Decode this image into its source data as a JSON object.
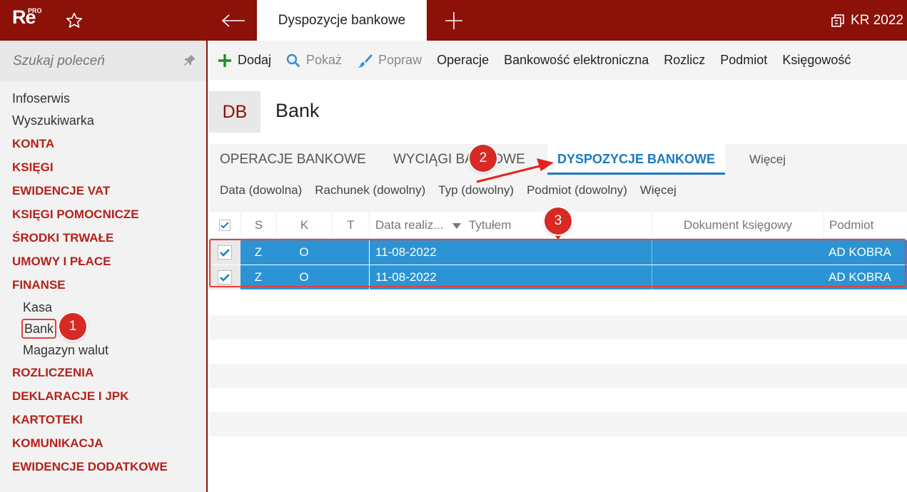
{
  "topbar": {
    "logo": "Re",
    "logo_badge": "PRO",
    "active_tab": "Dyspozycje bankowe",
    "company": "KR 2022"
  },
  "sidebar": {
    "search_placeholder": "Szukaj poleceń",
    "items": [
      {
        "label": "Infoserwis"
      },
      {
        "label": "Wyszukiwarka"
      },
      {
        "label": "KONTA"
      },
      {
        "label": "KSIĘGI"
      },
      {
        "label": "EWIDENCJE VAT"
      },
      {
        "label": "KSIĘGI POMOCNICZE"
      },
      {
        "label": "ŚRODKI TRWAŁE"
      },
      {
        "label": "UMOWY I PŁACE"
      },
      {
        "label": "FINANSE"
      },
      {
        "label": "Kasa"
      },
      {
        "label": "Bank"
      },
      {
        "label": "Magazyn walut"
      },
      {
        "label": "ROZLICZENIA"
      },
      {
        "label": "DEKLARACJE I JPK"
      },
      {
        "label": "KARTOTEKI"
      },
      {
        "label": "KOMUNIKACJA"
      },
      {
        "label": "EWIDENCJE DODATKOWE"
      }
    ]
  },
  "toolbar": {
    "add": "Dodaj",
    "show": "Pokaż",
    "edit": "Popraw",
    "operations": "Operacje",
    "ebanking": "Bankowość elektroniczna",
    "settle": "Rozlicz",
    "entity": "Podmiot",
    "accounting": "Księgowość"
  },
  "header": {
    "badge": "DB",
    "title": "Bank"
  },
  "tabs": {
    "t1": "OPERACJE BANKOWE",
    "t2": "WYCIĄGI BANKOWE",
    "t3": "DYSPOZYCJE BANKOWE",
    "more": "Więcej"
  },
  "filters": {
    "date": "Data (dowolna)",
    "account": "Rachunek (dowolny)",
    "type": "Typ (dowolny)",
    "entity": "Podmiot (dowolny)",
    "more": "Więcej"
  },
  "grid": {
    "columns": {
      "s": "S",
      "k": "K",
      "t": "T",
      "date": "Data realiz...",
      "title": "Tytułem",
      "doc": "Dokument księgowy",
      "entity": "Podmiot"
    },
    "rows": [
      {
        "s": "Z",
        "k": "O",
        "t": "",
        "date": "11-08-2022",
        "title": "",
        "doc": "",
        "entity": "AD KOBRA"
      },
      {
        "s": "Z",
        "k": "O",
        "t": "",
        "date": "11-08-2022",
        "title": "",
        "doc": "",
        "entity": "AD KOBRA"
      }
    ]
  },
  "markers": {
    "m1": "1",
    "m2": "2",
    "m3": "3"
  },
  "colors": {
    "brand": "#8b1109",
    "category": "#b5211a",
    "active_tab": "#1a7bbf",
    "selection": "#2c94d4",
    "marker": "#d62a22"
  }
}
